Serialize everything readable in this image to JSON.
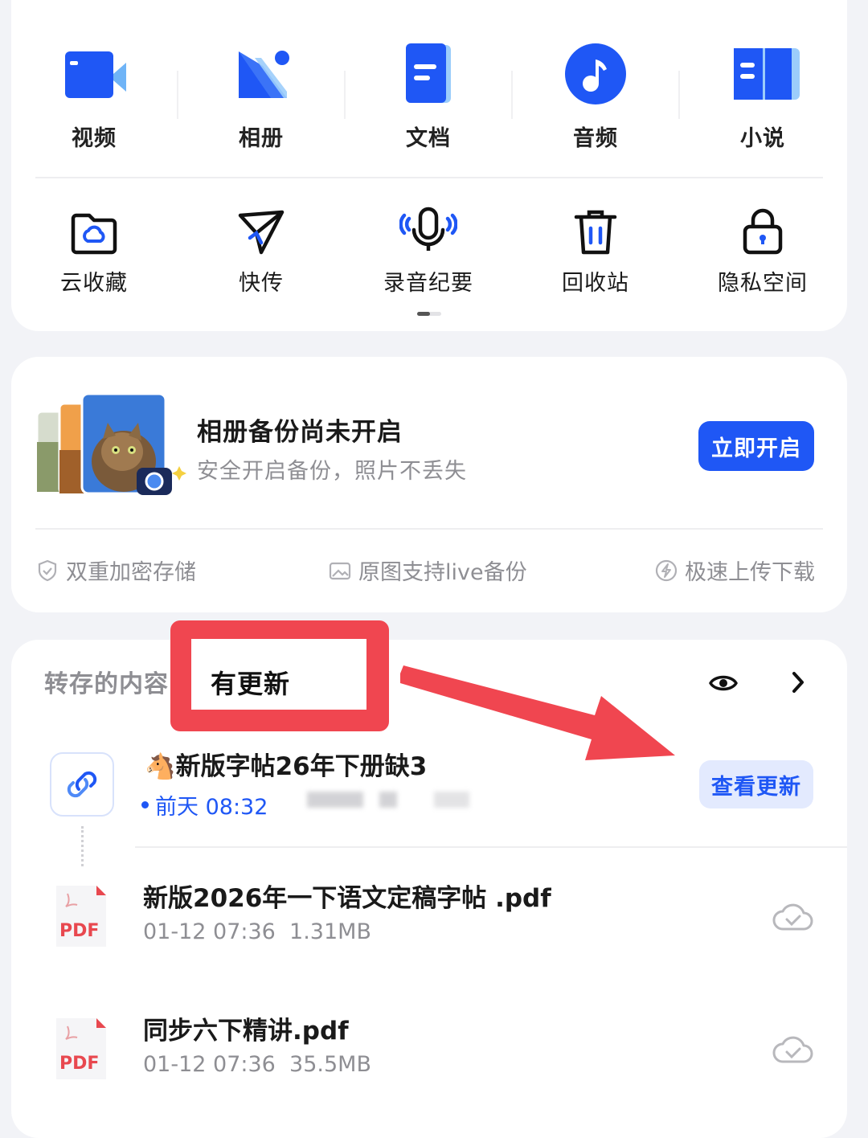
{
  "categories_row1": [
    {
      "label": "视频",
      "icon": "video-icon"
    },
    {
      "label": "相册",
      "icon": "album-icon"
    },
    {
      "label": "文档",
      "icon": "document-icon"
    },
    {
      "label": "音频",
      "icon": "audio-icon"
    },
    {
      "label": "小说",
      "icon": "novel-icon"
    }
  ],
  "categories_row2": [
    {
      "label": "云收藏",
      "icon": "cloud-collect-icon"
    },
    {
      "label": "快传",
      "icon": "quick-send-icon"
    },
    {
      "label": "录音纪要",
      "icon": "microphone-icon"
    },
    {
      "label": "回收站",
      "icon": "trash-icon"
    },
    {
      "label": "隐私空间",
      "icon": "lock-icon"
    }
  ],
  "backup": {
    "title": "相册备份尚未开启",
    "subtitle": "安全开启备份，照片不丢失",
    "button": "立即开启",
    "features": [
      "双重加密存储",
      "原图支持live备份",
      "极速上传下载"
    ]
  },
  "saved": {
    "title": "转存的内容",
    "callout": "有更新",
    "share": {
      "emoji": "🐴",
      "title": "新版字帖26年下册缺3",
      "time": "前天 08:32",
      "button": "查看更新"
    },
    "files": [
      {
        "name": "新版2026年一下语文定稿字帖 .pdf",
        "date": "01-12 07:36",
        "size": "1.31MB",
        "type": "PDF"
      },
      {
        "name": "同步六下精讲.pdf",
        "date": "01-12 07:36",
        "size": "35.5MB",
        "type": "PDF"
      }
    ]
  },
  "colors": {
    "accent": "#1f57f5",
    "callout": "#f04650",
    "muted": "#8e8e93"
  }
}
